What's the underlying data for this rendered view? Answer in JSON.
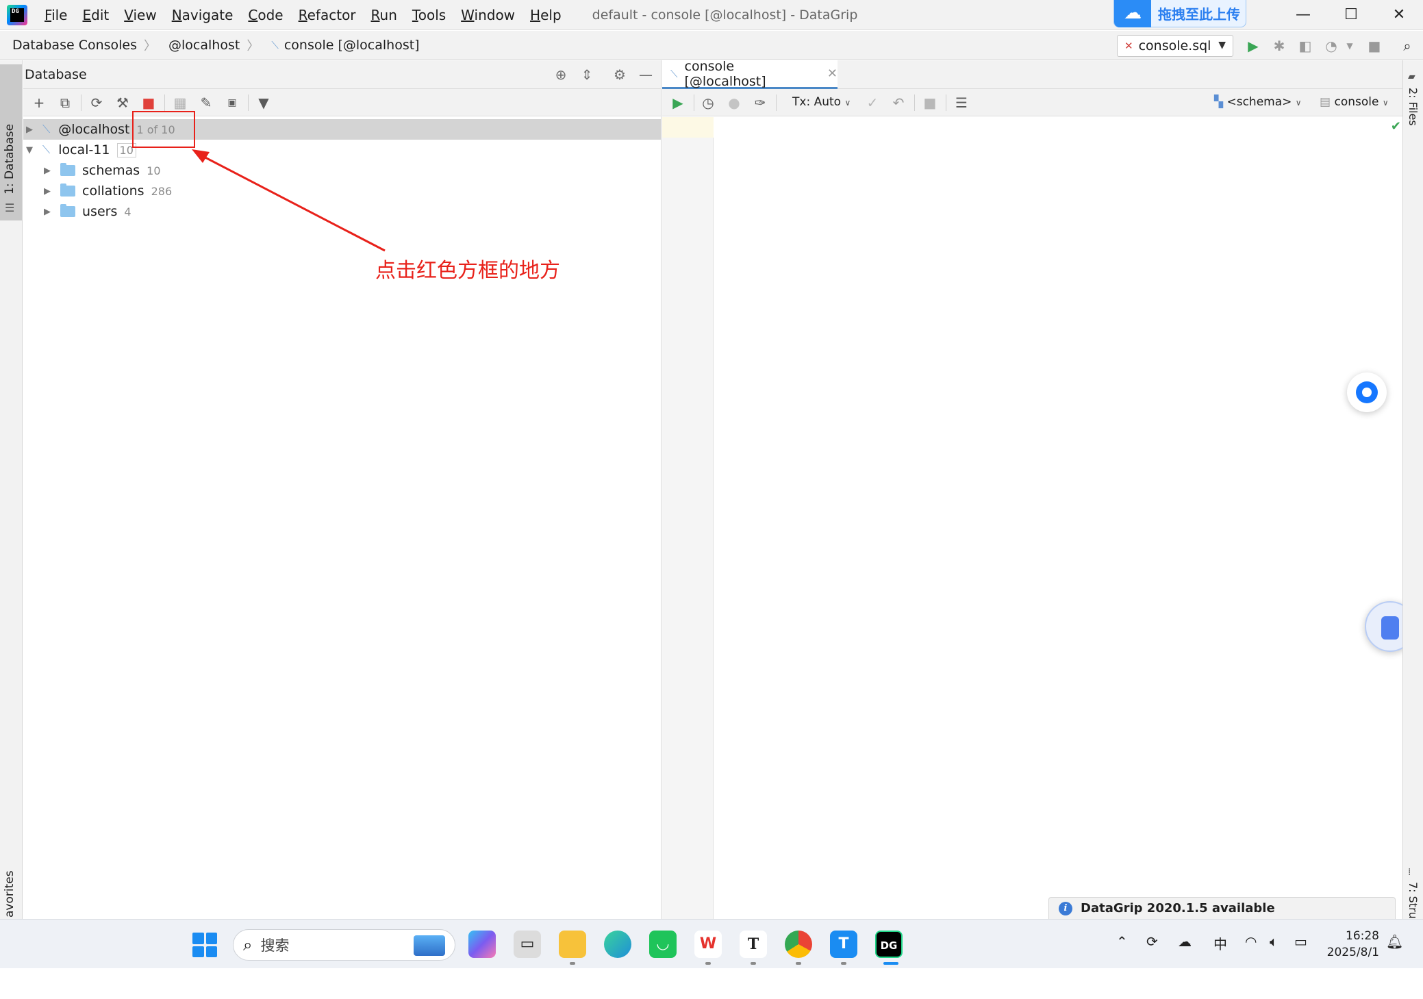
{
  "title_bar": {
    "menu": [
      {
        "key": "F",
        "rest": "ile"
      },
      {
        "key": "E",
        "rest": "dit"
      },
      {
        "key": "V",
        "rest": "iew"
      },
      {
        "key": "N",
        "rest": "avigate"
      },
      {
        "key": "C",
        "rest": "ode"
      },
      {
        "key": "R",
        "rest": "efactor"
      },
      {
        "key": "R",
        "rest": "un"
      },
      {
        "key": "T",
        "rest": "ools"
      },
      {
        "key": "W",
        "rest": "indow"
      },
      {
        "key": "H",
        "rest": "elp"
      }
    ],
    "window_title": "default - console [@localhost] - DataGrip",
    "logo_text": "DG",
    "upload_label": "拖拽至此上传"
  },
  "nav_bar": {
    "breadcrumb": [
      "Database Consoles",
      "@localhost",
      "console [@localhost]"
    ],
    "run_config": "console.sql"
  },
  "left_stripe": {
    "database_tab": "1: Database",
    "favorites_tab": "avorites"
  },
  "db_panel": {
    "title": "Database",
    "tree": [
      {
        "label": "@localhost",
        "count": "1 of 10",
        "expanded": false,
        "selected": true
      },
      {
        "label": "local-11",
        "count": "10",
        "expanded": true,
        "selected": false
      },
      {
        "label": "schemas",
        "count": "10"
      },
      {
        "label": "collations",
        "count": "286"
      },
      {
        "label": "users",
        "count": "4"
      }
    ]
  },
  "annotation": {
    "text": "点击红色方框的地方",
    "color": "#e8211a"
  },
  "editor": {
    "tab_label": "console [@localhost]",
    "tx_mode": "Tx: Auto",
    "schema_selector": "<schema>",
    "console_selector": "console"
  },
  "right_stripe": {
    "files_tab": "2: Files",
    "structure_tab": "7: Stru"
  },
  "notification": {
    "text": "DataGrip 2020.1.5 available"
  },
  "taskbar": {
    "search_placeholder": "搜索",
    "ime": "中",
    "time": "16:28",
    "date": "2025/8/1",
    "apps": [
      {
        "name": "copilot",
        "label": "",
        "color": "#7b5cf0"
      },
      {
        "name": "task-view",
        "label": "",
        "color": "#3a3a3a"
      },
      {
        "name": "file-explorer",
        "label": "",
        "color": "#f7c23a"
      },
      {
        "name": "edge",
        "label": "",
        "color": "#1f8fd8"
      },
      {
        "name": "wechat-app",
        "label": "",
        "color": "#1fc45a"
      },
      {
        "name": "wps",
        "label": "W",
        "color": "#e5322d"
      },
      {
        "name": "typora",
        "label": "T",
        "color": "#ffffff"
      },
      {
        "name": "chrome",
        "label": "",
        "color": "#ea4335"
      },
      {
        "name": "t-app",
        "label": "T",
        "color": "#1a8cf2"
      },
      {
        "name": "datagrip",
        "label": "DG",
        "color": "#000000"
      }
    ]
  },
  "colors": {
    "accent": "#4a88c7",
    "run_green": "#3aa655",
    "stop_red": "#e0403a"
  }
}
